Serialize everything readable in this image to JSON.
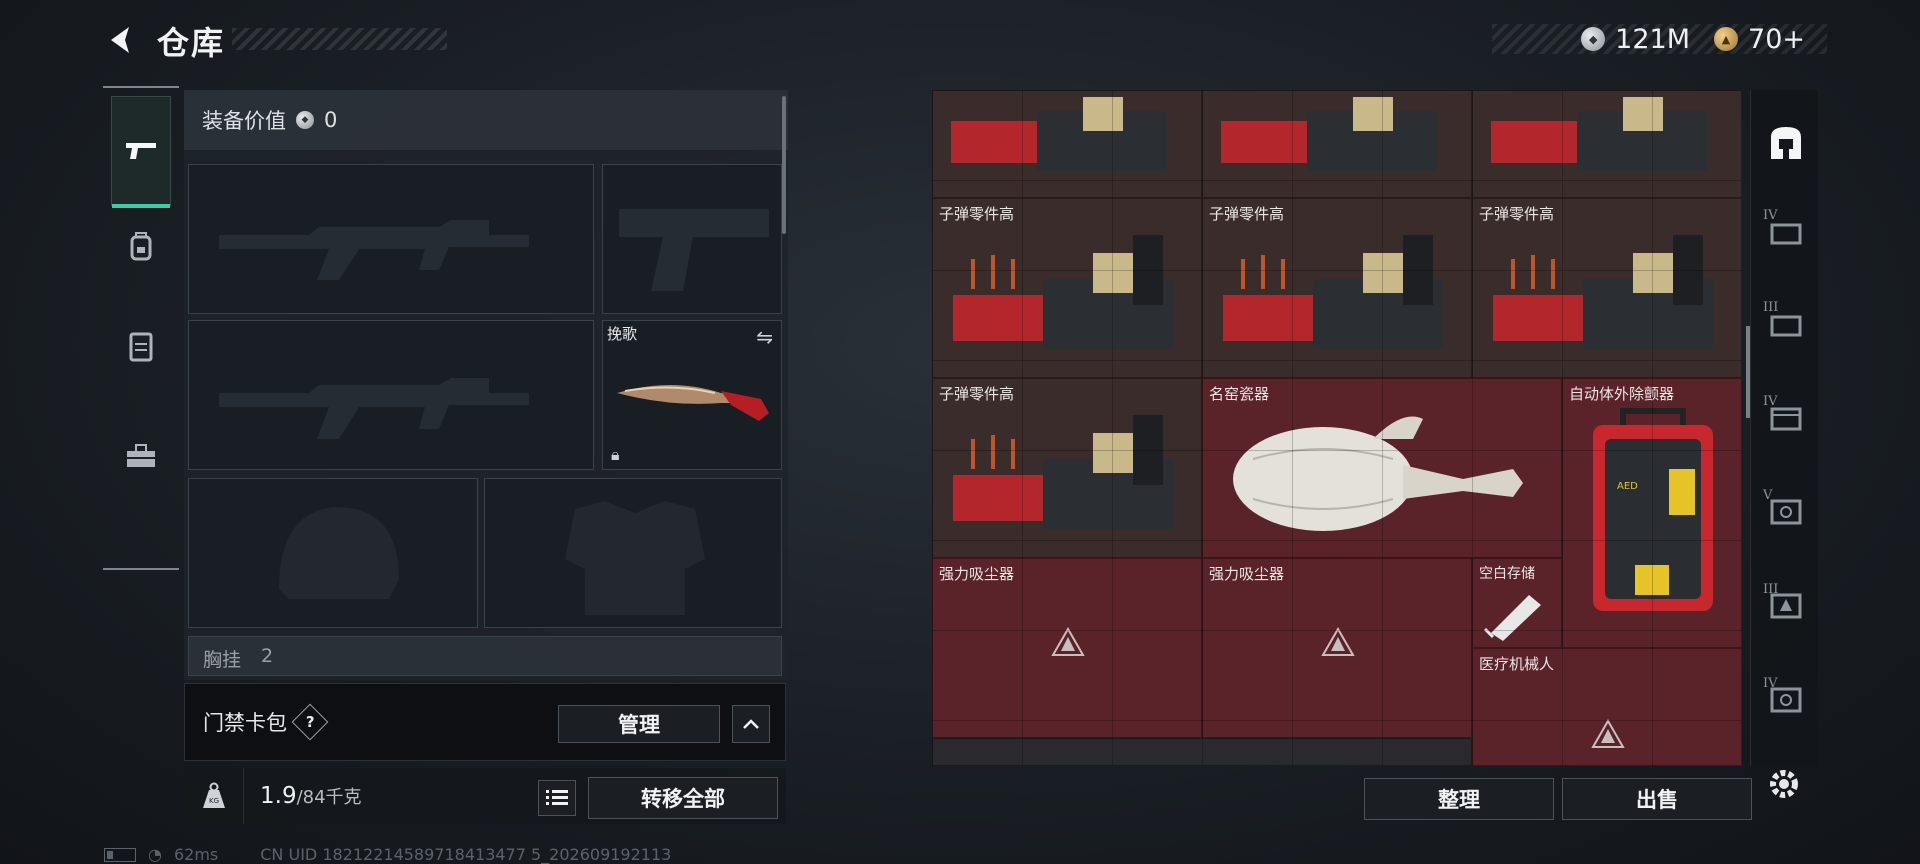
{
  "header": {
    "title": "仓库",
    "currencies": [
      {
        "icon": "silver-coin-icon",
        "value": "121M"
      },
      {
        "icon": "gold-coin-icon",
        "value": "70+"
      }
    ]
  },
  "left_tabs": [
    {
      "name": "pistol-icon",
      "active": true
    },
    {
      "name": "backpack-icon",
      "active": false
    },
    {
      "name": "vest-icon",
      "active": false
    },
    {
      "name": "toolbox-icon",
      "active": false
    }
  ],
  "equipment": {
    "value_label": "装备价值",
    "value": "0",
    "melee_slot_label": "挽歌",
    "chest_rig_label": "胸挂",
    "chest_rig_count": "2"
  },
  "card_bag": {
    "label": "门禁卡包",
    "help": "?",
    "manage_label": "管理"
  },
  "weight": {
    "current": "1.9",
    "max": "/84千克",
    "transfer_all_label": "转移全部"
  },
  "status_bar": {
    "ping": "62ms",
    "uid": "CN UID 18212214589718413477 5_202609192113"
  },
  "warehouse": {
    "items": [
      {
        "label": ""
      },
      {
        "label": ""
      },
      {
        "label": ""
      },
      {
        "label": "子弹零件高"
      },
      {
        "label": "子弹零件高"
      },
      {
        "label": "子弹零件高"
      },
      {
        "label": "子弹零件高"
      },
      {
        "label": "名窑瓷器"
      },
      {
        "label": "自动体外除颤器"
      },
      {
        "label": "强力吸尘器"
      },
      {
        "label": "强力吸尘器"
      },
      {
        "label": "空白存储"
      },
      {
        "label": "医疗机械人"
      }
    ],
    "sort_label": "整理",
    "sell_label": "出售",
    "colors": {
      "brown": "#3a2c2a",
      "red": "#5a2329",
      "accent": "#38d1a6"
    }
  },
  "right_rail": [
    {
      "name": "container-icon",
      "tier": ""
    },
    {
      "name": "tier-iv-case-icon",
      "tier": "IV"
    },
    {
      "name": "tier-iii-case-icon",
      "tier": "III"
    },
    {
      "name": "tier-iv-box-icon",
      "tier": "IV"
    },
    {
      "name": "tier-v-safe-icon",
      "tier": "V"
    },
    {
      "name": "tier-iii-box-icon",
      "tier": "III"
    },
    {
      "name": "tier-iv-safe-icon",
      "tier": "IV"
    }
  ]
}
